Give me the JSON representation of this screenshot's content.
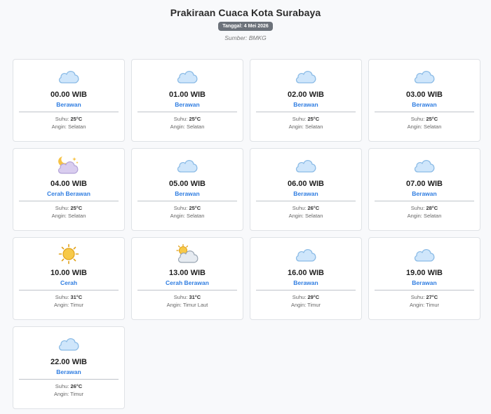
{
  "page": {
    "title": "Prakiraan Cuaca Kota Surabaya",
    "date_badge": "Tanggal: 4 Mei 2026",
    "source": "Sumber: BMKG"
  },
  "labels": {
    "temp_prefix": "Suhu: ",
    "wind_prefix": "Angin: "
  },
  "forecasts": [
    {
      "time": "00.00 WIB",
      "condition": "Berawan",
      "temp": "25°C",
      "wind": "Selatan",
      "icon": "cloud-icon"
    },
    {
      "time": "01.00 WIB",
      "condition": "Berawan",
      "temp": "25°C",
      "wind": "Selatan",
      "icon": "cloud-icon"
    },
    {
      "time": "02.00 WIB",
      "condition": "Berawan",
      "temp": "25°C",
      "wind": "Selatan",
      "icon": "cloud-icon"
    },
    {
      "time": "03.00 WIB",
      "condition": "Berawan",
      "temp": "25°C",
      "wind": "Selatan",
      "icon": "cloud-icon"
    },
    {
      "time": "04.00 WIB",
      "condition": "Cerah Berawan",
      "temp": "25°C",
      "wind": "Selatan",
      "icon": "moon-cloud-icon"
    },
    {
      "time": "05.00 WIB",
      "condition": "Berawan",
      "temp": "25°C",
      "wind": "Selatan",
      "icon": "cloud-icon"
    },
    {
      "time": "06.00 WIB",
      "condition": "Berawan",
      "temp": "26°C",
      "wind": "Selatan",
      "icon": "cloud-icon"
    },
    {
      "time": "07.00 WIB",
      "condition": "Berawan",
      "temp": "28°C",
      "wind": "Selatan",
      "icon": "cloud-icon"
    },
    {
      "time": "10.00 WIB",
      "condition": "Cerah",
      "temp": "31°C",
      "wind": "Timur",
      "icon": "sun-icon"
    },
    {
      "time": "13.00 WIB",
      "condition": "Cerah Berawan",
      "temp": "31°C",
      "wind": "Timur Laut",
      "icon": "sun-cloud-icon"
    },
    {
      "time": "16.00 WIB",
      "condition": "Berawan",
      "temp": "29°C",
      "wind": "Timur",
      "icon": "cloud-icon"
    },
    {
      "time": "19.00 WIB",
      "condition": "Berawan",
      "temp": "27°C",
      "wind": "Timur",
      "icon": "cloud-icon"
    },
    {
      "time": "22.00 WIB",
      "condition": "Berawan",
      "temp": "26°C",
      "wind": "Timur",
      "icon": "cloud-icon"
    }
  ],
  "colors": {
    "condition_text": "#2f7de1",
    "cloud_fill": "#cfe6fb",
    "cloud_stroke": "#8bbbe6",
    "night_cloud_fill": "#d9cdef",
    "sun_fill": "#f7c948"
  }
}
